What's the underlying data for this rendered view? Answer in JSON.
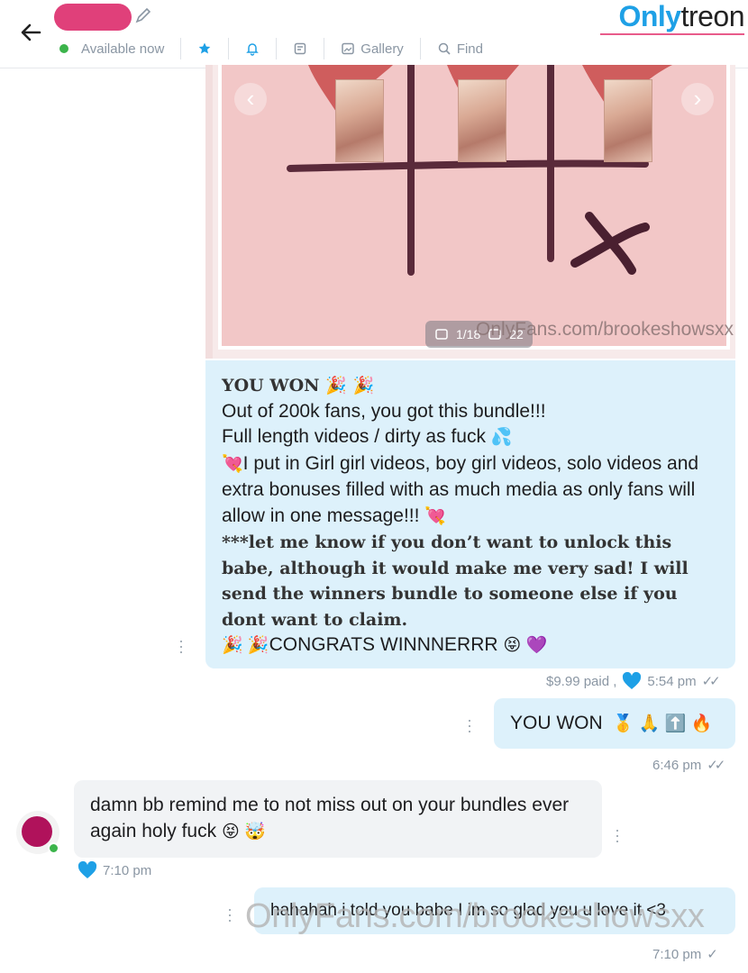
{
  "header": {
    "status_label": "Available now",
    "gallery_label": "Gallery",
    "find_label": "Find",
    "brand_left": "Only",
    "brand_right": "treon"
  },
  "media": {
    "counter": "1/18",
    "counter_extra": "22",
    "watermark": "OnlyFans.com/brookeshowsxx"
  },
  "messages": {
    "m1": {
      "title": "YOU WON",
      "line1": "Out of 200k fans, you got this bundle!!!",
      "line2": "Full length videos / dirty as fuck",
      "line3": "I put in Girl girl videos, boy girl videos, solo videos and extra bonuses filled with as much media as only fans will allow in one message!!!",
      "line4": "***let me know if you don’t want to unlock this babe, although it would make me very sad! I will send the winners bundle to someone else if you dont want to claim.",
      "line5": "CONGRATS WINNNERRR",
      "price": "$9.99 paid ,",
      "time": "5:54 pm"
    },
    "m2": {
      "text": "YOU WON",
      "time": "6:46 pm"
    },
    "m3": {
      "text": "damn bb remind me to not miss out on your bundles ever again holy fuck",
      "time": "7:10 pm"
    },
    "m4": {
      "text": "hahahah i told you babe I im so glad you u love it <3",
      "time": "7:10 pm"
    }
  },
  "watermark_big": "OnlyFans.com/brookeshowsxx",
  "colors": {
    "accent": "#1ea0e6",
    "bubble": "#ddf1fb",
    "incoming": "#f1f3f5",
    "online": "#3cb44b"
  }
}
